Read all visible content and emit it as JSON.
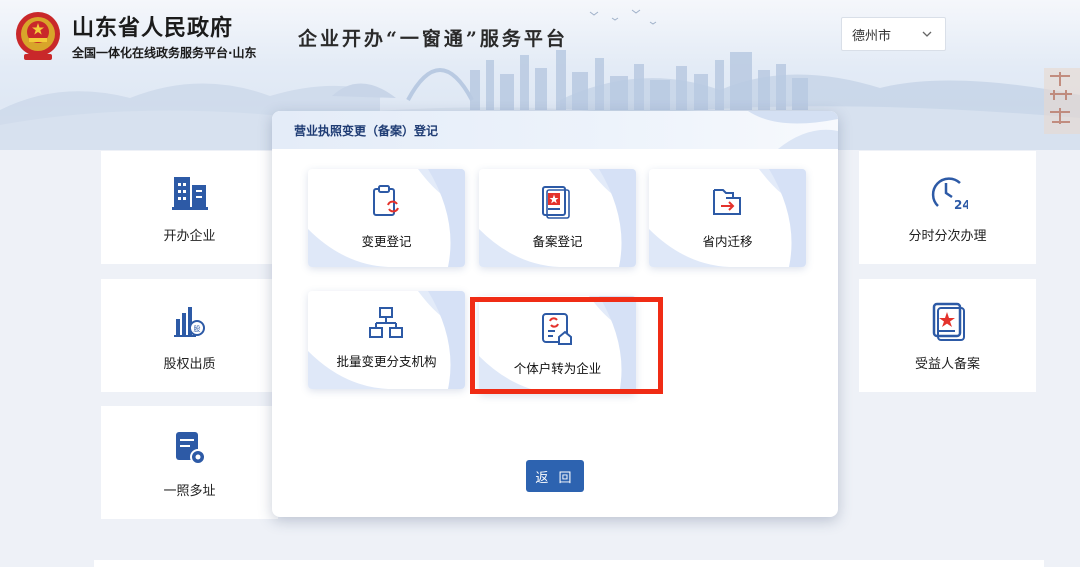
{
  "header": {
    "gov_title": "山东省人民政府",
    "gov_subtitle": "全国一体化在线政务服务平台·山东",
    "platform_title": "企业开办“一窗通”服务平台",
    "city_select": "德州市"
  },
  "tiles": {
    "left": [
      {
        "label": "开办企业",
        "icon": "building-icon"
      },
      {
        "label": "股权出质",
        "icon": "equity-chart-icon"
      },
      {
        "label": "一照多址",
        "icon": "doc-gear-icon"
      }
    ],
    "right": [
      {
        "label": "分时分次办理",
        "icon": "clock-24-icon"
      },
      {
        "label": "受益人备案",
        "icon": "star-certificate-icon"
      }
    ]
  },
  "modal": {
    "title": "营业执照变更（备案）登记",
    "options": [
      {
        "label": "变更登记",
        "icon": "clipboard-refresh-icon"
      },
      {
        "label": "备案登记",
        "icon": "star-doc-icon"
      },
      {
        "label": "省内迁移",
        "icon": "folder-arrow-icon"
      },
      {
        "label": "批量变更分支机构",
        "icon": "org-tree-icon"
      },
      {
        "label": "个体户转为企业",
        "icon": "doc-home-refresh-icon"
      }
    ],
    "back_label": "返 回"
  },
  "colors": {
    "primary_blue": "#2d63b0",
    "accent_red": "#e4322b",
    "highlight_red": "#f02c15",
    "header_text": "#1f3c74"
  }
}
